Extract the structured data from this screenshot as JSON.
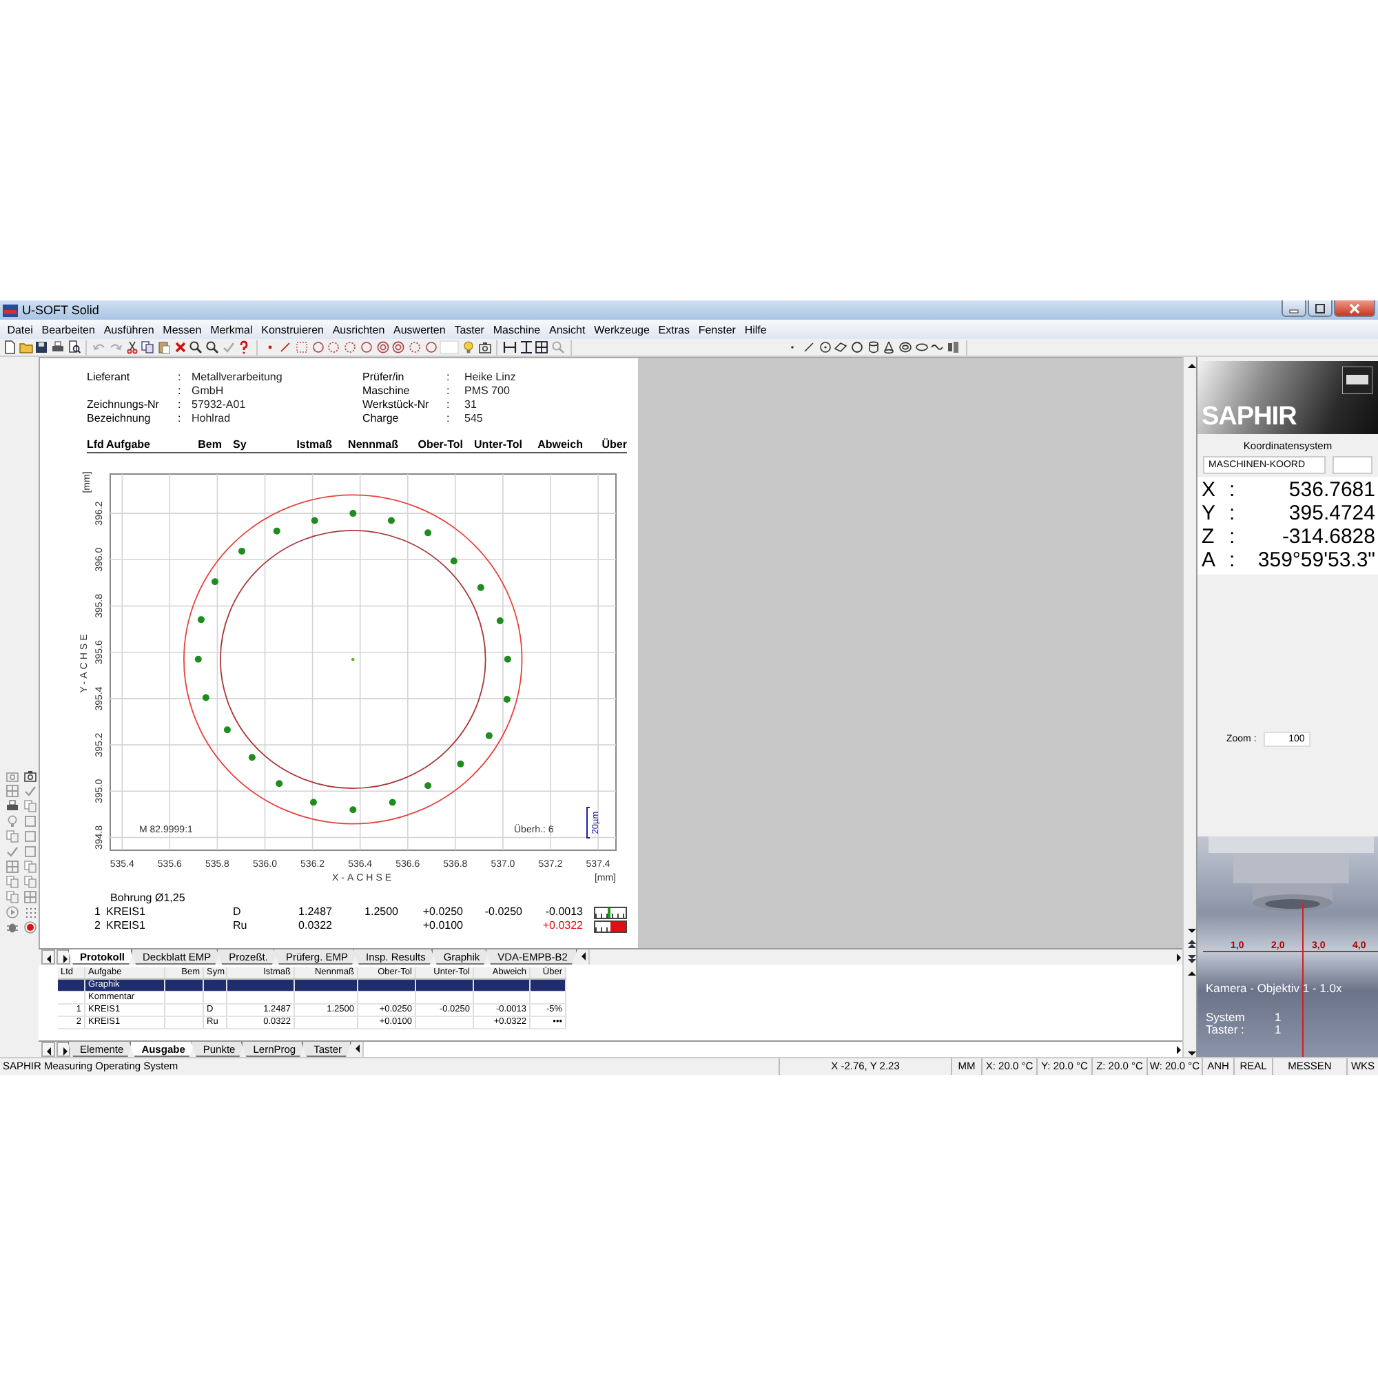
{
  "window": {
    "title": "U-SOFT Solid"
  },
  "menu": [
    "Datei",
    "Bearbeiten",
    "Ausführen",
    "Messen",
    "Merkmal",
    "Konstruieren",
    "Ausrichten",
    "Auswerten",
    "Taster",
    "Maschine",
    "Ansicht",
    "Werkzeuge",
    "Extras",
    "Fenster",
    "Hilfe"
  ],
  "report": {
    "header_left": [
      {
        "label": "Lieferant",
        "colon": ":",
        "value": "Metallverarbeitung"
      },
      {
        "colon": ":",
        "value": "GmbH"
      },
      {
        "label": "Zeichnungs-Nr",
        "colon": ":",
        "value": "57932-A01"
      },
      {
        "label": "Bezeichnung",
        "colon": ":",
        "value": "Hohlrad"
      }
    ],
    "header_right": [
      {
        "label": "Prüfer/in",
        "colon": ":",
        "value": "Heike Linz"
      },
      {
        "label": "Maschine",
        "colon": ":",
        "value": "PMS 700"
      },
      {
        "label": "Werkstück-Nr",
        "colon": ":",
        "value": "31"
      },
      {
        "label": "Charge",
        "colon": ":",
        "value": "545"
      }
    ],
    "columns": [
      "Lfd",
      "Aufgabe",
      "Bem",
      "Sy",
      "Istmaß",
      "Nennmaß",
      "Ober-Tol",
      "Unter-Tol",
      "Abweich",
      "Über"
    ],
    "chart_data": {
      "type": "scatter",
      "grid": true,
      "xlabel": "X-ACHSE",
      "ylabel": "Y-ACHSE",
      "xlim": [
        535.35,
        537.475
      ],
      "ylim": [
        394.745,
        396.37
      ],
      "x": [
        537.02,
        536.988,
        536.907,
        536.794,
        536.685,
        536.531,
        536.37,
        536.209,
        536.05,
        535.903,
        535.79,
        535.732,
        535.72,
        535.752,
        535.842,
        535.946,
        536.06,
        536.204,
        536.37,
        536.536,
        536.685,
        536.822,
        536.942,
        537.017
      ],
      "xticks": [
        535.4,
        535.6,
        535.8,
        {
          "value": 536,
          "label": "536.0"
        },
        536.2,
        536.4,
        536.6,
        536.8,
        {
          "value": 537,
          "label": "537.0"
        },
        537.2,
        537.4
      ],
      "yticks": [
        394.8,
        {
          "value": 395,
          "label": "395.0"
        },
        395.2,
        395.4,
        395.6,
        395.8,
        {
          "value": 396,
          "label": "396.0"
        },
        396.2
      ],
      "series": [
        {
          "color": "#1e8c1e",
          "values": [
            395.57,
            395.736,
            395.88,
            395.994,
            396.116,
            396.169,
            396.2,
            396.169,
            396.124,
            396.037,
            395.905,
            395.741,
            395.57,
            395.404,
            395.265,
            395.146,
            395.033,
            394.952,
            394.92,
            394.952,
            395.024,
            395.118,
            395.24,
            395.397
          ]
        }
      ]
    },
    "chart_notes": {
      "scale": "M 82.9999:1",
      "overhang": "Überh.: 6",
      "scale_bar": "20µm",
      "x_unit": "[mm]",
      "y_unit": "[mm]"
    },
    "group_title": "Bohrung Ø1,25",
    "rows": [
      {
        "lfd": "1",
        "aufgabe": "KREIS1",
        "sym": "D",
        "istmass": "1.2487",
        "nennmass": "1.2500",
        "ober_tol": "+0.0250",
        "unter_tol": "-0.0250",
        "abweich": "-0.0013",
        "out_of_tolerance": false,
        "level": 0.47
      },
      {
        "lfd": "2",
        "aufgabe": "KREIS1",
        "sym": "Ru",
        "istmass": "0.0322",
        "ober_tol": "+0.0100",
        "abweich": "+0.0322",
        "out_of_tolerance": true
      }
    ]
  },
  "doc_tabs": [
    {
      "label": "Protokoll",
      "selected": true
    },
    {
      "label": "Deckblatt EMP",
      "selected": false
    },
    {
      "label": "Prozeßt.",
      "selected": false
    },
    {
      "label": "Prüferg. EMP",
      "selected": false
    },
    {
      "label": "Insp. Results",
      "selected": false
    },
    {
      "label": "Graphik",
      "selected": false
    },
    {
      "label": "VDA-EMPB-B2",
      "selected": false
    }
  ],
  "lower_table": {
    "columns": [
      "Ltd",
      "Aufgabe",
      "Bem",
      "Sym",
      "Istmaß",
      "Nennmaß",
      "Ober-Tol",
      "Unter-Tol",
      "Abweich",
      "Über"
    ],
    "rows": [
      {
        "aufgabe": "Graphik",
        "selected": true
      },
      {
        "aufgabe": "Kommentar",
        "selected": false
      },
      {
        "lfd": "1",
        "aufgabe": "KREIS1",
        "sym": "D",
        "istmass": "1.2487",
        "nennmass": "1.2500",
        "ober_tol": "+0.0250",
        "unter_tol": "-0.0250",
        "abweich": "-0.0013",
        "ueber": "-5%",
        "selected": false
      },
      {
        "lfd": "2",
        "aufgabe": "KREIS1",
        "sym": "Ru",
        "istmass": "0.0322",
        "ober_tol": "+0.0100",
        "abweich": "+0.0322",
        "ueber": "•••",
        "selected": false
      }
    ]
  },
  "lower_tabs": [
    {
      "label": "Elemente",
      "selected": false
    },
    {
      "label": "Ausgabe",
      "selected": true
    },
    {
      "label": "Punkte",
      "selected": false
    },
    {
      "label": "LernProg",
      "selected": false
    },
    {
      "label": "Taster",
      "selected": false
    }
  ],
  "right_panel": {
    "logo": "SAPHIR",
    "coord_system_label": "Koordinatensystem",
    "coord_system": "MASCHINEN-KOORD",
    "coordinates": [
      {
        "axis": "X",
        "colon": ":",
        "value": "536.7681"
      },
      {
        "axis": "Y",
        "colon": ":",
        "value": "395.4724"
      },
      {
        "axis": "Z",
        "colon": ":",
        "value": "-314.6828"
      },
      {
        "axis": "A",
        "colon": ":",
        "value": "359°59'53.3\""
      }
    ],
    "zoom_label": "Zoom :",
    "zoom_value": "100",
    "camera": {
      "scale_labels": [
        "1,0",
        "2,0",
        "3,0",
        "4,0"
      ],
      "title": "Kamera - Objektiv 1 - 1.0x",
      "lines": [
        {
          "label": "System",
          "value": "1"
        },
        {
          "label": "Taster :",
          "value": "1"
        }
      ]
    }
  },
  "status_bar": {
    "message": "SAPHIR Measuring Operating System",
    "position": "X -2.76, Y 2.23",
    "cells": [
      "MM",
      "X: 20.0 °C",
      "Y: 20.0 °C",
      "Z: 20.0 °C",
      "W: 20.0 °C",
      "ANH",
      "REAL",
      "MESSEN",
      "WKS"
    ]
  }
}
